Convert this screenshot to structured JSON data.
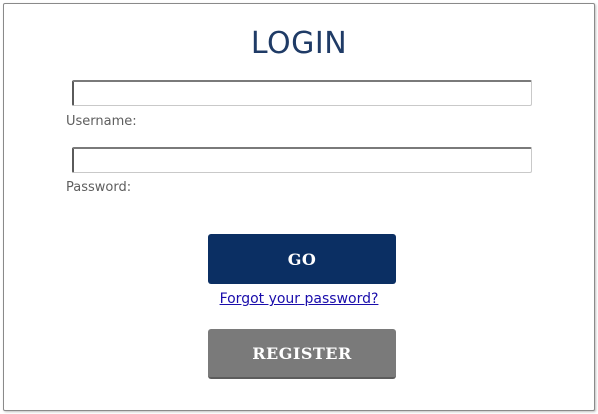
{
  "login": {
    "title": "LOGIN",
    "username": {
      "label": "Username:",
      "value": "",
      "placeholder": ""
    },
    "password": {
      "label": "Password:",
      "value": "",
      "placeholder": ""
    },
    "go_label": "GO",
    "forgot_label": "Forgot your password?",
    "register_label": "REGISTER"
  },
  "colors": {
    "title": "#1f3b66",
    "go_button": "#0b2f63",
    "register_button": "#7a7a7a",
    "link": "#1a0dab"
  }
}
